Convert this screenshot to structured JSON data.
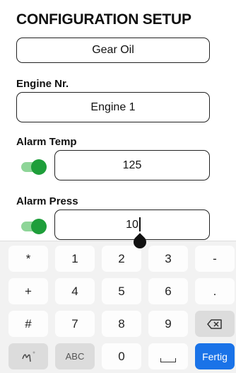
{
  "header": {
    "title": "CONFIGURATION SETUP"
  },
  "form": {
    "oil_type_value": "Gear Oil",
    "engine_label": "Engine Nr.",
    "engine_value": "Engine 1",
    "alarm_temp_label": "Alarm Temp",
    "alarm_temp_value": "125",
    "alarm_temp_enabled": true,
    "alarm_press_label": "Alarm Press",
    "alarm_press_value": "10",
    "alarm_press_enabled": true,
    "toggle_color": "#1e9e3a"
  },
  "keyboard": {
    "row1": [
      "*",
      "1",
      "2",
      "3",
      "-"
    ],
    "row2": [
      "+",
      "4",
      "5",
      "6",
      "."
    ],
    "row3": [
      "#",
      "7",
      "8",
      "9"
    ],
    "backspace_icon": "backspace-icon",
    "row4": {
      "gesture_icon": "handwriting-icon",
      "abc": "ABC",
      "zero": "0",
      "space_icon": "space-icon",
      "done": "Fertig"
    },
    "done_color": "#1a73e8"
  }
}
